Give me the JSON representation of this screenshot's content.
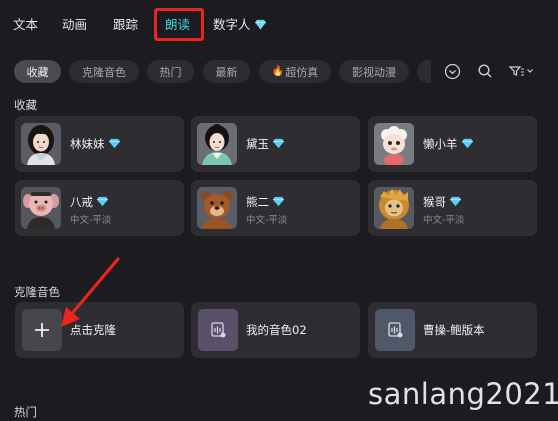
{
  "tabs": [
    {
      "label": "文本"
    },
    {
      "label": "动画"
    },
    {
      "label": "跟踪"
    },
    {
      "label": "朗读"
    },
    {
      "label": "数字人"
    }
  ],
  "active_tab": "朗读",
  "filters": [
    "收藏",
    "克隆音色",
    "热门",
    "最新",
    "超仿真",
    "影视动漫"
  ],
  "active_filter": "收藏",
  "favorites": {
    "title": "收藏",
    "items": [
      {
        "name": "林妹妹",
        "sub": "",
        "icon": "lin-avatar"
      },
      {
        "name": "黛玉",
        "sub": "",
        "icon": "daiyu-avatar"
      },
      {
        "name": "懒小羊",
        "sub": "",
        "icon": "sheep-avatar"
      },
      {
        "name": "八戒",
        "sub": "中文-平淡",
        "icon": "pig-avatar"
      },
      {
        "name": "熊二",
        "sub": "中文-平淡",
        "icon": "bear-avatar"
      },
      {
        "name": "猴哥",
        "sub": "中文-平淡",
        "icon": "monkey-avatar"
      }
    ]
  },
  "clone": {
    "title": "克隆音色",
    "items": [
      {
        "label": "点击克隆",
        "icon": "plus-icon"
      },
      {
        "label": "我的音色02",
        "icon": "voice-file-icon"
      },
      {
        "label": "曹操-鲍版本",
        "icon": "voice-file-icon"
      }
    ]
  },
  "hot": {
    "title": "热门"
  },
  "watermark": "sanlang2021",
  "colors": {
    "accent": "#35d6d6",
    "highlight": "#e8261e",
    "diamond": "#5ad0f0",
    "background": "#1c1c20",
    "card": "#2d2d32"
  }
}
